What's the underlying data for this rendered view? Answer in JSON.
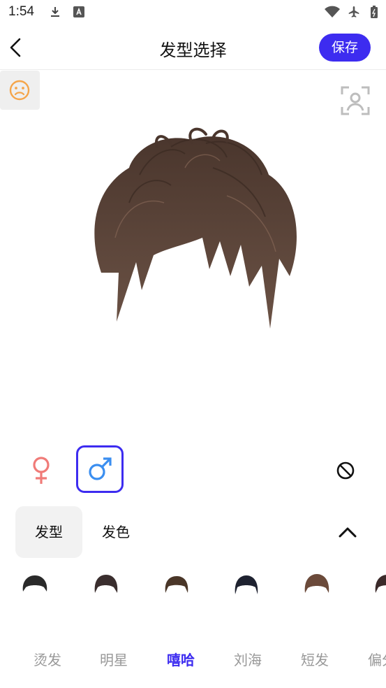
{
  "status_bar": {
    "time": "1:54"
  },
  "header": {
    "title": "发型选择",
    "save_label": "保存"
  },
  "tabs": {
    "style": "发型",
    "color": "发色"
  },
  "categories": [
    "烫发",
    "明星",
    "嘻哈",
    "刘海",
    "短发",
    "偏分"
  ],
  "active_category_index": 2,
  "colors": {
    "accent": "#3d2cf0",
    "hair": "#5a4438",
    "female": "#f07b78",
    "male": "#3a8ef0"
  }
}
